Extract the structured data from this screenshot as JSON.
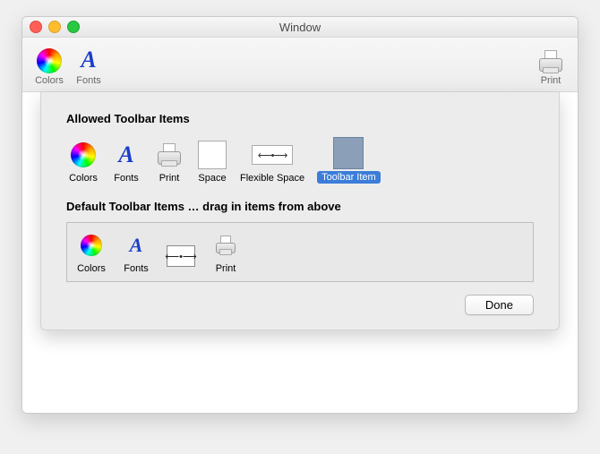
{
  "window": {
    "title": "Window"
  },
  "toolbar": {
    "items": [
      {
        "name": "colors",
        "label": "Colors"
      },
      {
        "name": "fonts",
        "label": "Fonts"
      },
      {
        "name": "print",
        "label": "Print"
      }
    ]
  },
  "sheet": {
    "allowed_title": "Allowed Toolbar Items",
    "default_title": "Default Toolbar Items … drag in items from above",
    "done_label": "Done",
    "allowed": [
      {
        "name": "colors",
        "label": "Colors"
      },
      {
        "name": "fonts",
        "label": "Fonts"
      },
      {
        "name": "print",
        "label": "Print"
      },
      {
        "name": "space",
        "label": "Space"
      },
      {
        "name": "flexible-space",
        "label": "Flexible Space"
      },
      {
        "name": "toolbar-item",
        "label": "Toolbar Item",
        "selected": true
      }
    ],
    "default": [
      {
        "name": "colors",
        "label": "Colors"
      },
      {
        "name": "fonts",
        "label": "Fonts"
      },
      {
        "name": "flexible-space",
        "label": ""
      },
      {
        "name": "print",
        "label": "Print"
      }
    ]
  }
}
